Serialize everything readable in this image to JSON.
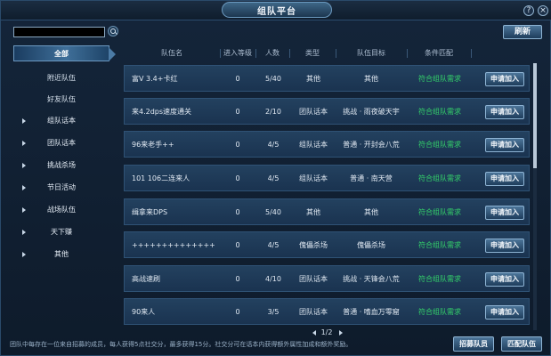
{
  "window": {
    "title": "组队平台",
    "help_icon": "?",
    "close_icon": "×"
  },
  "search": {
    "value": "",
    "icon": "search-icon"
  },
  "refresh_label": "刷新",
  "sidebar": {
    "items": [
      {
        "label": "全部",
        "active": true,
        "has_arrow": false
      },
      {
        "label": "附近队伍",
        "has_arrow": false
      },
      {
        "label": "好友队伍",
        "has_arrow": false
      },
      {
        "label": "组队话本",
        "has_arrow": true
      },
      {
        "label": "团队话本",
        "has_arrow": true
      },
      {
        "label": "挑战杀场",
        "has_arrow": true
      },
      {
        "label": "节日活动",
        "has_arrow": true
      },
      {
        "label": "战场队伍",
        "has_arrow": true
      },
      {
        "label": "天下赚",
        "has_arrow": true
      },
      {
        "label": "其他",
        "has_arrow": true
      }
    ]
  },
  "table": {
    "headers": [
      "队伍名",
      "进入等级",
      "人数",
      "类型",
      "队伍目标",
      "条件匹配"
    ],
    "apply_label": "申请加入",
    "rows": [
      {
        "name": "富V 3.4+卡红",
        "level": "0",
        "count": "5/40",
        "type": "其他",
        "goal": "其他",
        "match": "符合组队需求"
      },
      {
        "name": "来4.2dps速度通关",
        "level": "0",
        "count": "2/10",
        "type": "团队话本",
        "goal": "挑战 · 雨夜破天宇",
        "match": "符合组队需求"
      },
      {
        "name": "96来老手++",
        "level": "0",
        "count": "4/5",
        "type": "组队话本",
        "goal": "普通 · 开封会八荒",
        "match": "符合组队需求"
      },
      {
        "name": "101 106二连来人",
        "level": "0",
        "count": "4/5",
        "type": "组队话本",
        "goal": "普通 · 南天营",
        "match": "符合组队需求"
      },
      {
        "name": "缉拿来DPS",
        "level": "0",
        "count": "5/40",
        "type": "其他",
        "goal": "其他",
        "match": "符合组队需求"
      },
      {
        "name": "++++++++++++++",
        "level": "0",
        "count": "4/5",
        "type": "傀儡杀场",
        "goal": "傀儡杀场",
        "match": "符合组队需求"
      },
      {
        "name": "高战速刷",
        "level": "0",
        "count": "4/10",
        "type": "团队话本",
        "goal": "挑战 · 天锋会八荒",
        "match": "符合组队需求"
      },
      {
        "name": "90来人",
        "level": "0",
        "count": "3/5",
        "type": "团队话本",
        "goal": "普通 · 嗜血万零窟",
        "match": "符合组队需求"
      }
    ]
  },
  "pager": {
    "label": "1/2"
  },
  "footer": {
    "text": "团队中每存在一位来自招募的成员，每人获得5点社交分，最多获得15分。社交分可在话本内获得额外属性加成和额外奖励。",
    "recruit_label": "招募队员",
    "match_label": "匹配队伍"
  },
  "colors": {
    "match_green": "#34d36a",
    "button_top": "#4c7599",
    "button_bottom": "#1e3d5c"
  }
}
